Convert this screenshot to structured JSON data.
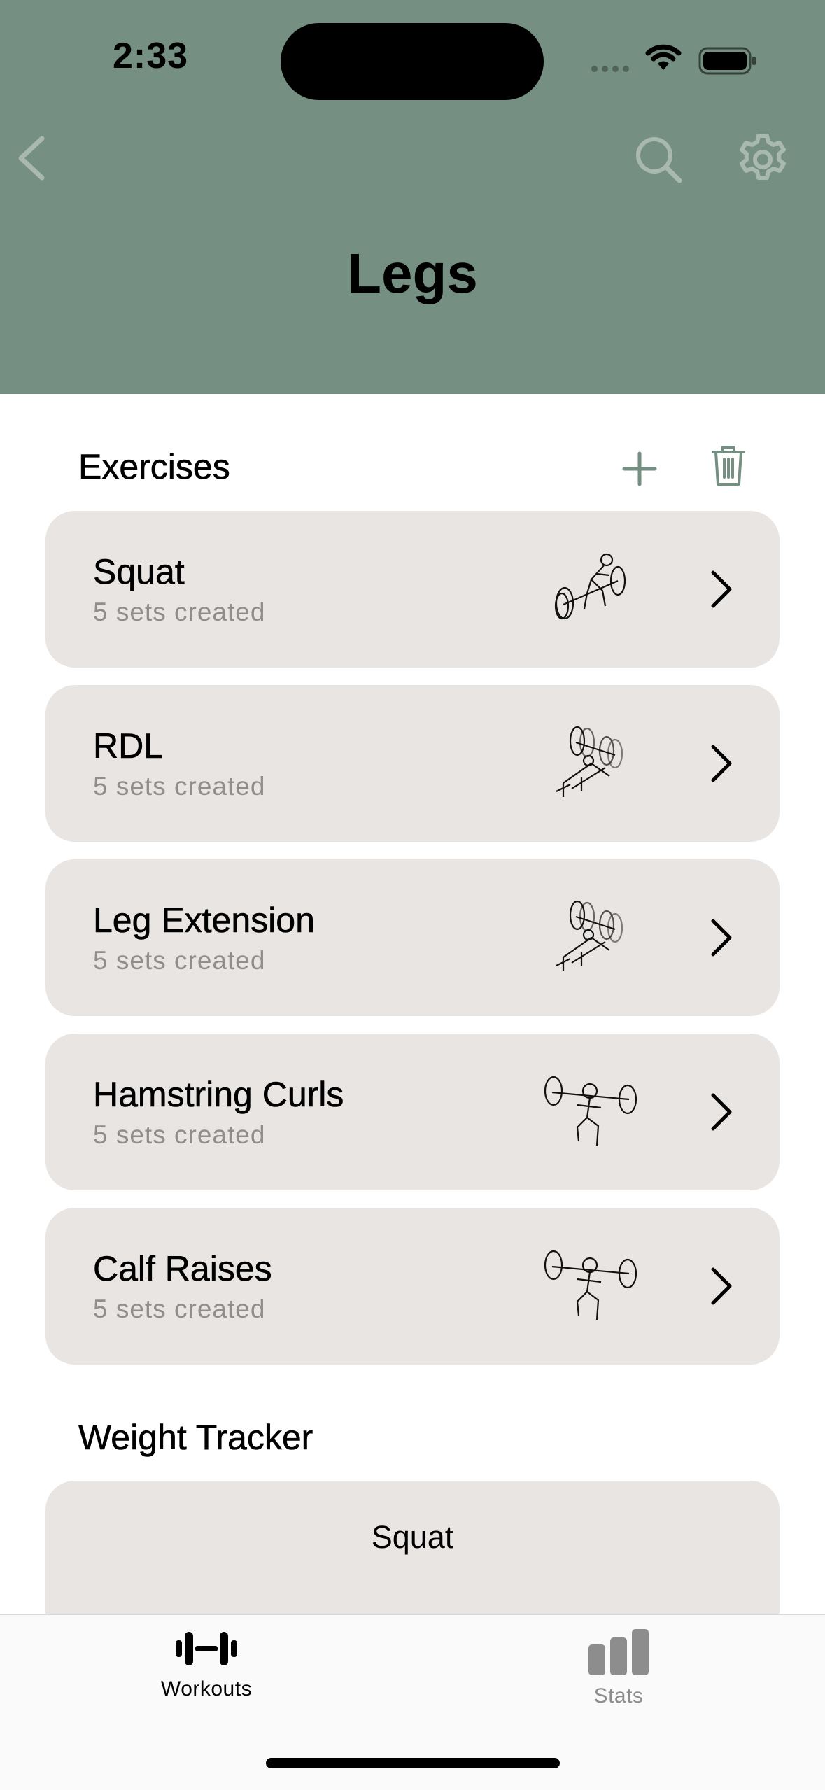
{
  "status_bar": {
    "time": "2:33"
  },
  "header": {
    "title": "Legs",
    "background_color": "#758f82",
    "icons": [
      "chevron-left-icon",
      "search-icon",
      "gear-icon"
    ]
  },
  "exercises_section": {
    "title": "Exercises",
    "items": [
      {
        "name": "Squat",
        "subtitle": "5 sets created",
        "illustration": "squat-figure"
      },
      {
        "name": "RDL",
        "subtitle": "5 sets created",
        "illustration": "bench-figure"
      },
      {
        "name": "Leg Extension",
        "subtitle": "5 sets created",
        "illustration": "bench-figure"
      },
      {
        "name": "Hamstring Curls",
        "subtitle": "5 sets created",
        "illustration": "barbell-figure"
      },
      {
        "name": "Calf Raises",
        "subtitle": "5 sets created",
        "illustration": "barbell-figure"
      }
    ]
  },
  "weight_tracker_section": {
    "title": "Weight Tracker",
    "selected_exercise": "Squat"
  },
  "tab_bar": {
    "tabs": [
      {
        "label": "Workouts",
        "icon": "dumbbell-icon",
        "active": true
      },
      {
        "label": "Stats",
        "icon": "bar-chart-icon",
        "active": false
      }
    ],
    "active_color": "#000000",
    "inactive_color": "#8d8d8d"
  },
  "card_color": "#e8e5e2"
}
